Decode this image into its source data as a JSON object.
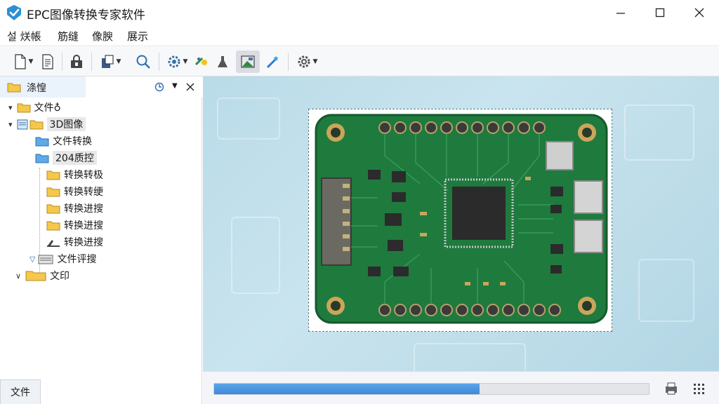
{
  "window": {
    "title": "EPC图像转换专家软件",
    "controls": {
      "minimize": "minimize-icon",
      "maximize": "maximize-icon",
      "close": "close-icon"
    }
  },
  "menu": {
    "items": [
      "설 烪帳",
      "筋缝",
      "像腴",
      "展示"
    ]
  },
  "toolbar": {
    "buttons": [
      "new-file-icon",
      "document-icon",
      "lock-icon",
      "export-icon",
      "search-icon",
      "settings-icon",
      "brush-icon",
      "flask-icon",
      "image-icon",
      "magic-wand-icon",
      "gear-icon"
    ],
    "active": "image-icon"
  },
  "panel": {
    "title": "涤惶",
    "bottom_tab": "文件"
  },
  "tree": [
    {
      "label": "文件♁",
      "expander": "▾"
    },
    {
      "label": "3D图像",
      "expander": "▾"
    },
    {
      "label": "文件转换"
    },
    {
      "label": "204质控"
    },
    {
      "label": "转换转极"
    },
    {
      "label": "转换转绠"
    },
    {
      "label": "转换进搜"
    },
    {
      "label": "转换进搜"
    },
    {
      "label": "转换进搜"
    },
    {
      "label": "文件评搜",
      "expander": "▽"
    },
    {
      "label": "文印",
      "expander": "∨"
    }
  ],
  "progress": {
    "value": 0.61
  },
  "colors": {
    "accent": "#3d8ad8",
    "pcb_green": "#1f7a3e",
    "canvas_bg": "#bfdfea"
  }
}
